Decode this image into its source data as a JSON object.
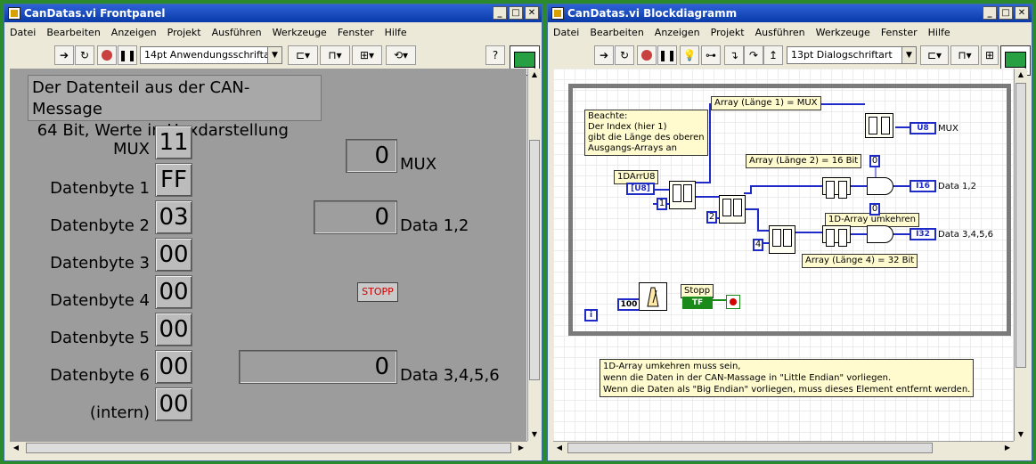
{
  "front": {
    "title": "CanDatas.vi Frontpanel",
    "menu": [
      "Datei",
      "Bearbeiten",
      "Anzeigen",
      "Projekt",
      "Ausführen",
      "Werkzeuge",
      "Fenster",
      "Hilfe"
    ],
    "font": "14pt Anwendungsschriftart",
    "help_glyph": "?",
    "heading_line1": "Der Datenteil aus der CAN-Message",
    "heading_line2": " 64 Bit, Werte in Hexdarstellung",
    "rows": [
      {
        "label": "MUX",
        "value": "11"
      },
      {
        "label": "Datenbyte 1",
        "value": "FF"
      },
      {
        "label": "Datenbyte 2",
        "value": "03"
      },
      {
        "label": "Datenbyte 3",
        "value": "00"
      },
      {
        "label": "Datenbyte 4",
        "value": "00"
      },
      {
        "label": "Datenbyte 5",
        "value": "00"
      },
      {
        "label": "Datenbyte 6",
        "value": "00"
      },
      {
        "label": "(intern)",
        "value": "00"
      }
    ],
    "indicators": [
      {
        "value": "0",
        "label": "MUX"
      },
      {
        "value": "0",
        "label": "Data 1,2"
      },
      {
        "value": "0",
        "label": "Data 3,4,5,6"
      }
    ],
    "stop_label": "STOPP"
  },
  "block": {
    "title": "CanDatas.vi Blockdiagramm",
    "menu": [
      "Datei",
      "Bearbeiten",
      "Anzeigen",
      "Projekt",
      "Ausführen",
      "Werkzeuge",
      "Fenster",
      "Hilfe"
    ],
    "font": "13pt Dialogschriftart",
    "note_line1": "Beachte:",
    "note_line2": "Der Index (hier 1)",
    "note_line3": "gibt die Länge des oberen",
    "note_line4": "Ausgangs-Arrays an",
    "label_arr1": "Array (Länge 1) = MUX",
    "label_arr2": "Array (Länge 2) = 16 Bit",
    "label_arr4": "Array (Länge 4) = 32 Bit",
    "label_reverse": "1D-Array umkehren",
    "input_label": "1DArrU8",
    "input_type": "[U8]",
    "const1": "1",
    "const2": "2",
    "const4": "4",
    "const0a": "0",
    "const0b": "0",
    "out_mux_type": "U8",
    "out_mux_label": "MUX",
    "out_data12_type": "I16",
    "out_data12_label": "Data 1,2",
    "out_data3456_type": "I32",
    "out_data3456_label": "Data 3,4,5,6",
    "wait_const": "100",
    "stop_label": "Stopp",
    "stop_tf": "TF",
    "iter_label": "i",
    "bottom_note1": "1D-Array umkehren muss sein,",
    "bottom_note2": "wenn die Daten in der CAN-Massage in \"Little Endian\" vorliegen.",
    "bottom_note3": "Wenn die Daten als \"Big Endian\" vorliegen, muss dieses Element entfernt werden."
  }
}
